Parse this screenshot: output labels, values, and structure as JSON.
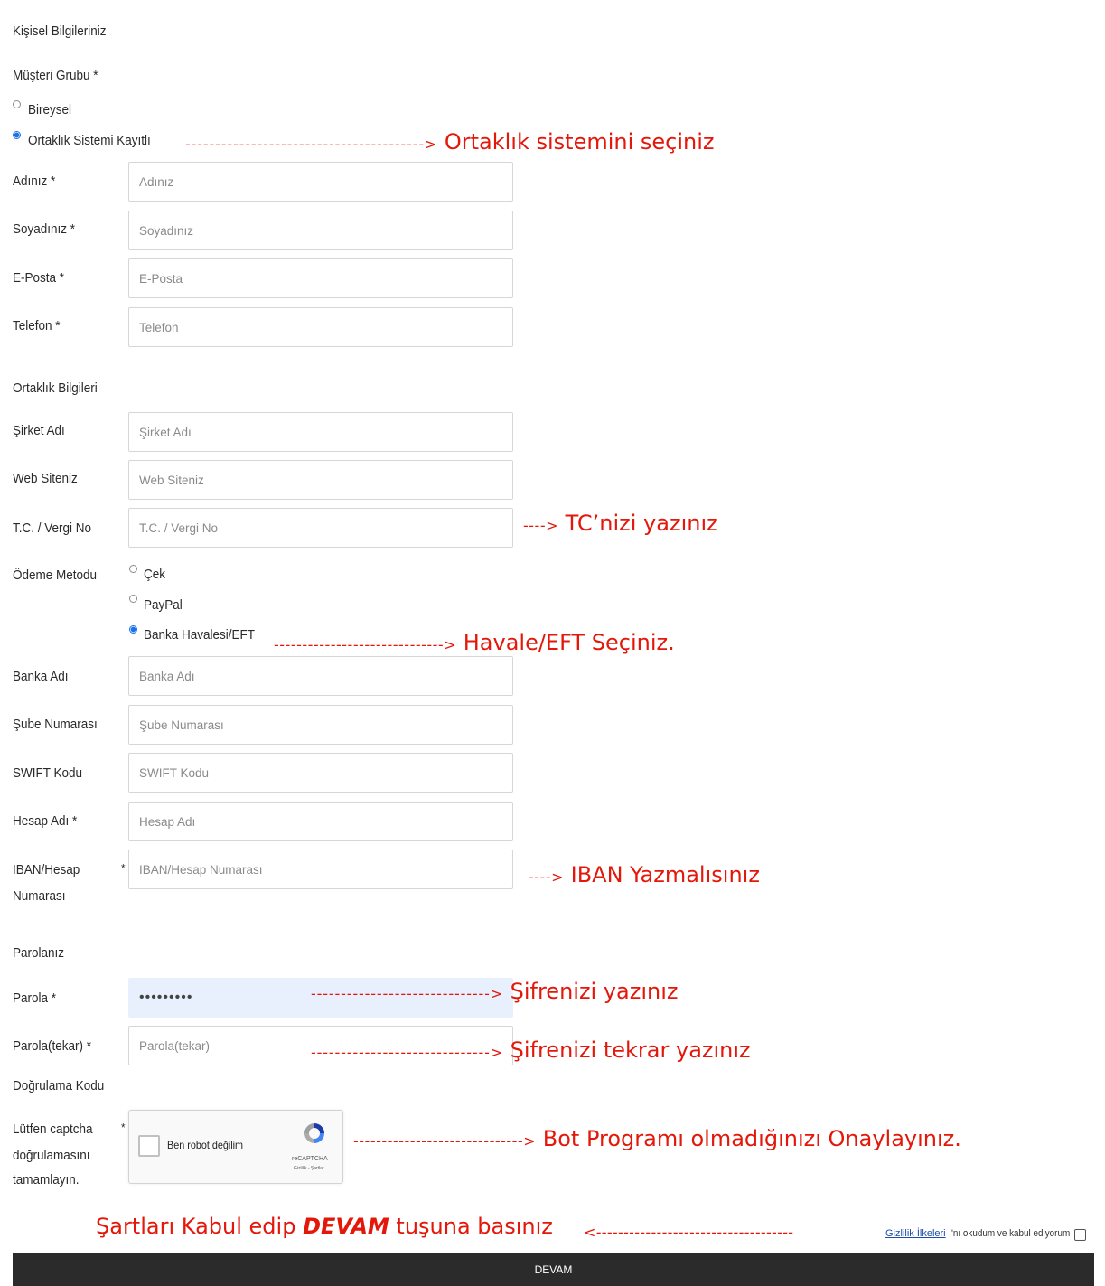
{
  "personal": {
    "section_title": "Kişisel Bilgileriniz",
    "customer_group_label": "Müşteri Grubu *",
    "option_individual": "Bireysel",
    "option_affiliate": "Ortaklık Sistemi Kayıtlı",
    "first_name_label": "Adınız *",
    "first_name_placeholder": "Adınız",
    "last_name_label": "Soyadınız *",
    "last_name_placeholder": "Soyadınız",
    "email_label": "E-Posta *",
    "email_placeholder": "E-Posta",
    "phone_label": "Telefon *",
    "phone_placeholder": "Telefon"
  },
  "affiliate": {
    "section_title": "Ortaklık Bilgileri",
    "company_label": "Şirket Adı",
    "company_placeholder": "Şirket Adı",
    "website_label": "Web Siteniz",
    "website_placeholder": "Web Siteniz",
    "tax_label": "T.C. / Vergi No",
    "tax_placeholder": "T.C. / Vergi No",
    "payment_label": "Ödeme Metodu",
    "payment_cheque": "Çek",
    "payment_paypal": "PayPal",
    "payment_bank": "Banka Havalesi/EFT",
    "bank_name_label": "Banka Adı",
    "bank_name_placeholder": "Banka Adı",
    "branch_label": "Şube Numarası",
    "branch_placeholder": "Şube Numarası",
    "swift_label": "SWIFT Kodu",
    "swift_placeholder": "SWIFT Kodu",
    "account_name_label": "Hesap Adı *",
    "account_name_placeholder": "Hesap Adı",
    "iban_label_line1": "IBAN/Hesap",
    "iban_label_line2": "Numarası",
    "iban_star": "*",
    "iban_placeholder": "IBAN/Hesap Numarası"
  },
  "password": {
    "section_title": "Parolanız",
    "password_label": "Parola *",
    "password_value": "•••••••••",
    "confirm_label": "Parola(tekar) *",
    "confirm_placeholder": "Parola(tekar)"
  },
  "verification": {
    "section_title": "Doğrulama Kodu",
    "captcha_label_line1": "Lütfen captcha",
    "captcha_label_line2": "doğrulamasını",
    "captcha_label_line3": "tamamlayın.",
    "captcha_star": "*",
    "captcha_text": "Ben robot değilim",
    "recaptcha_brand": "reCAPTCHA",
    "recaptcha_links": "Gizlilik - Şartlar"
  },
  "terms": {
    "privacy_link": "Gizlilik İlkeleri",
    "accept_text": "'nı okudum ve kabul ediyorum"
  },
  "submit": {
    "label": "DEVAM"
  },
  "annotations": {
    "affiliate_dashes": "---------------------------------------->",
    "affiliate_text": "Ortaklık sistemini seçiniz",
    "tc_dashes": "---->",
    "tc_text": "TC’nizi yazınız",
    "eft_dashes": "------------------------------>",
    "eft_text": "Havale/EFT Seçiniz.",
    "iban_dashes": "---->",
    "iban_text": "IBAN Yazmalısınız",
    "password_dashes": "------------------------------>",
    "password_text": "Şifrenizi yazınız",
    "confirm_dashes": "------------------------------>",
    "confirm_text": "Şifrenizi tekrar yazınız",
    "bot_dashes": "------------------------------>",
    "bot_text": "Bot Programı olmadığınızı Onaylayınız.",
    "terms_prefix": "Şartları Kabul edip ",
    "terms_bold": "DEVAM",
    "terms_suffix": " tuşuna basınız",
    "terms_dashes": "<------------------------------------"
  },
  "colors": {
    "annotation": "#e3170a",
    "radio_selected": "#1a73e8",
    "button_bg": "#2b2b2b"
  }
}
